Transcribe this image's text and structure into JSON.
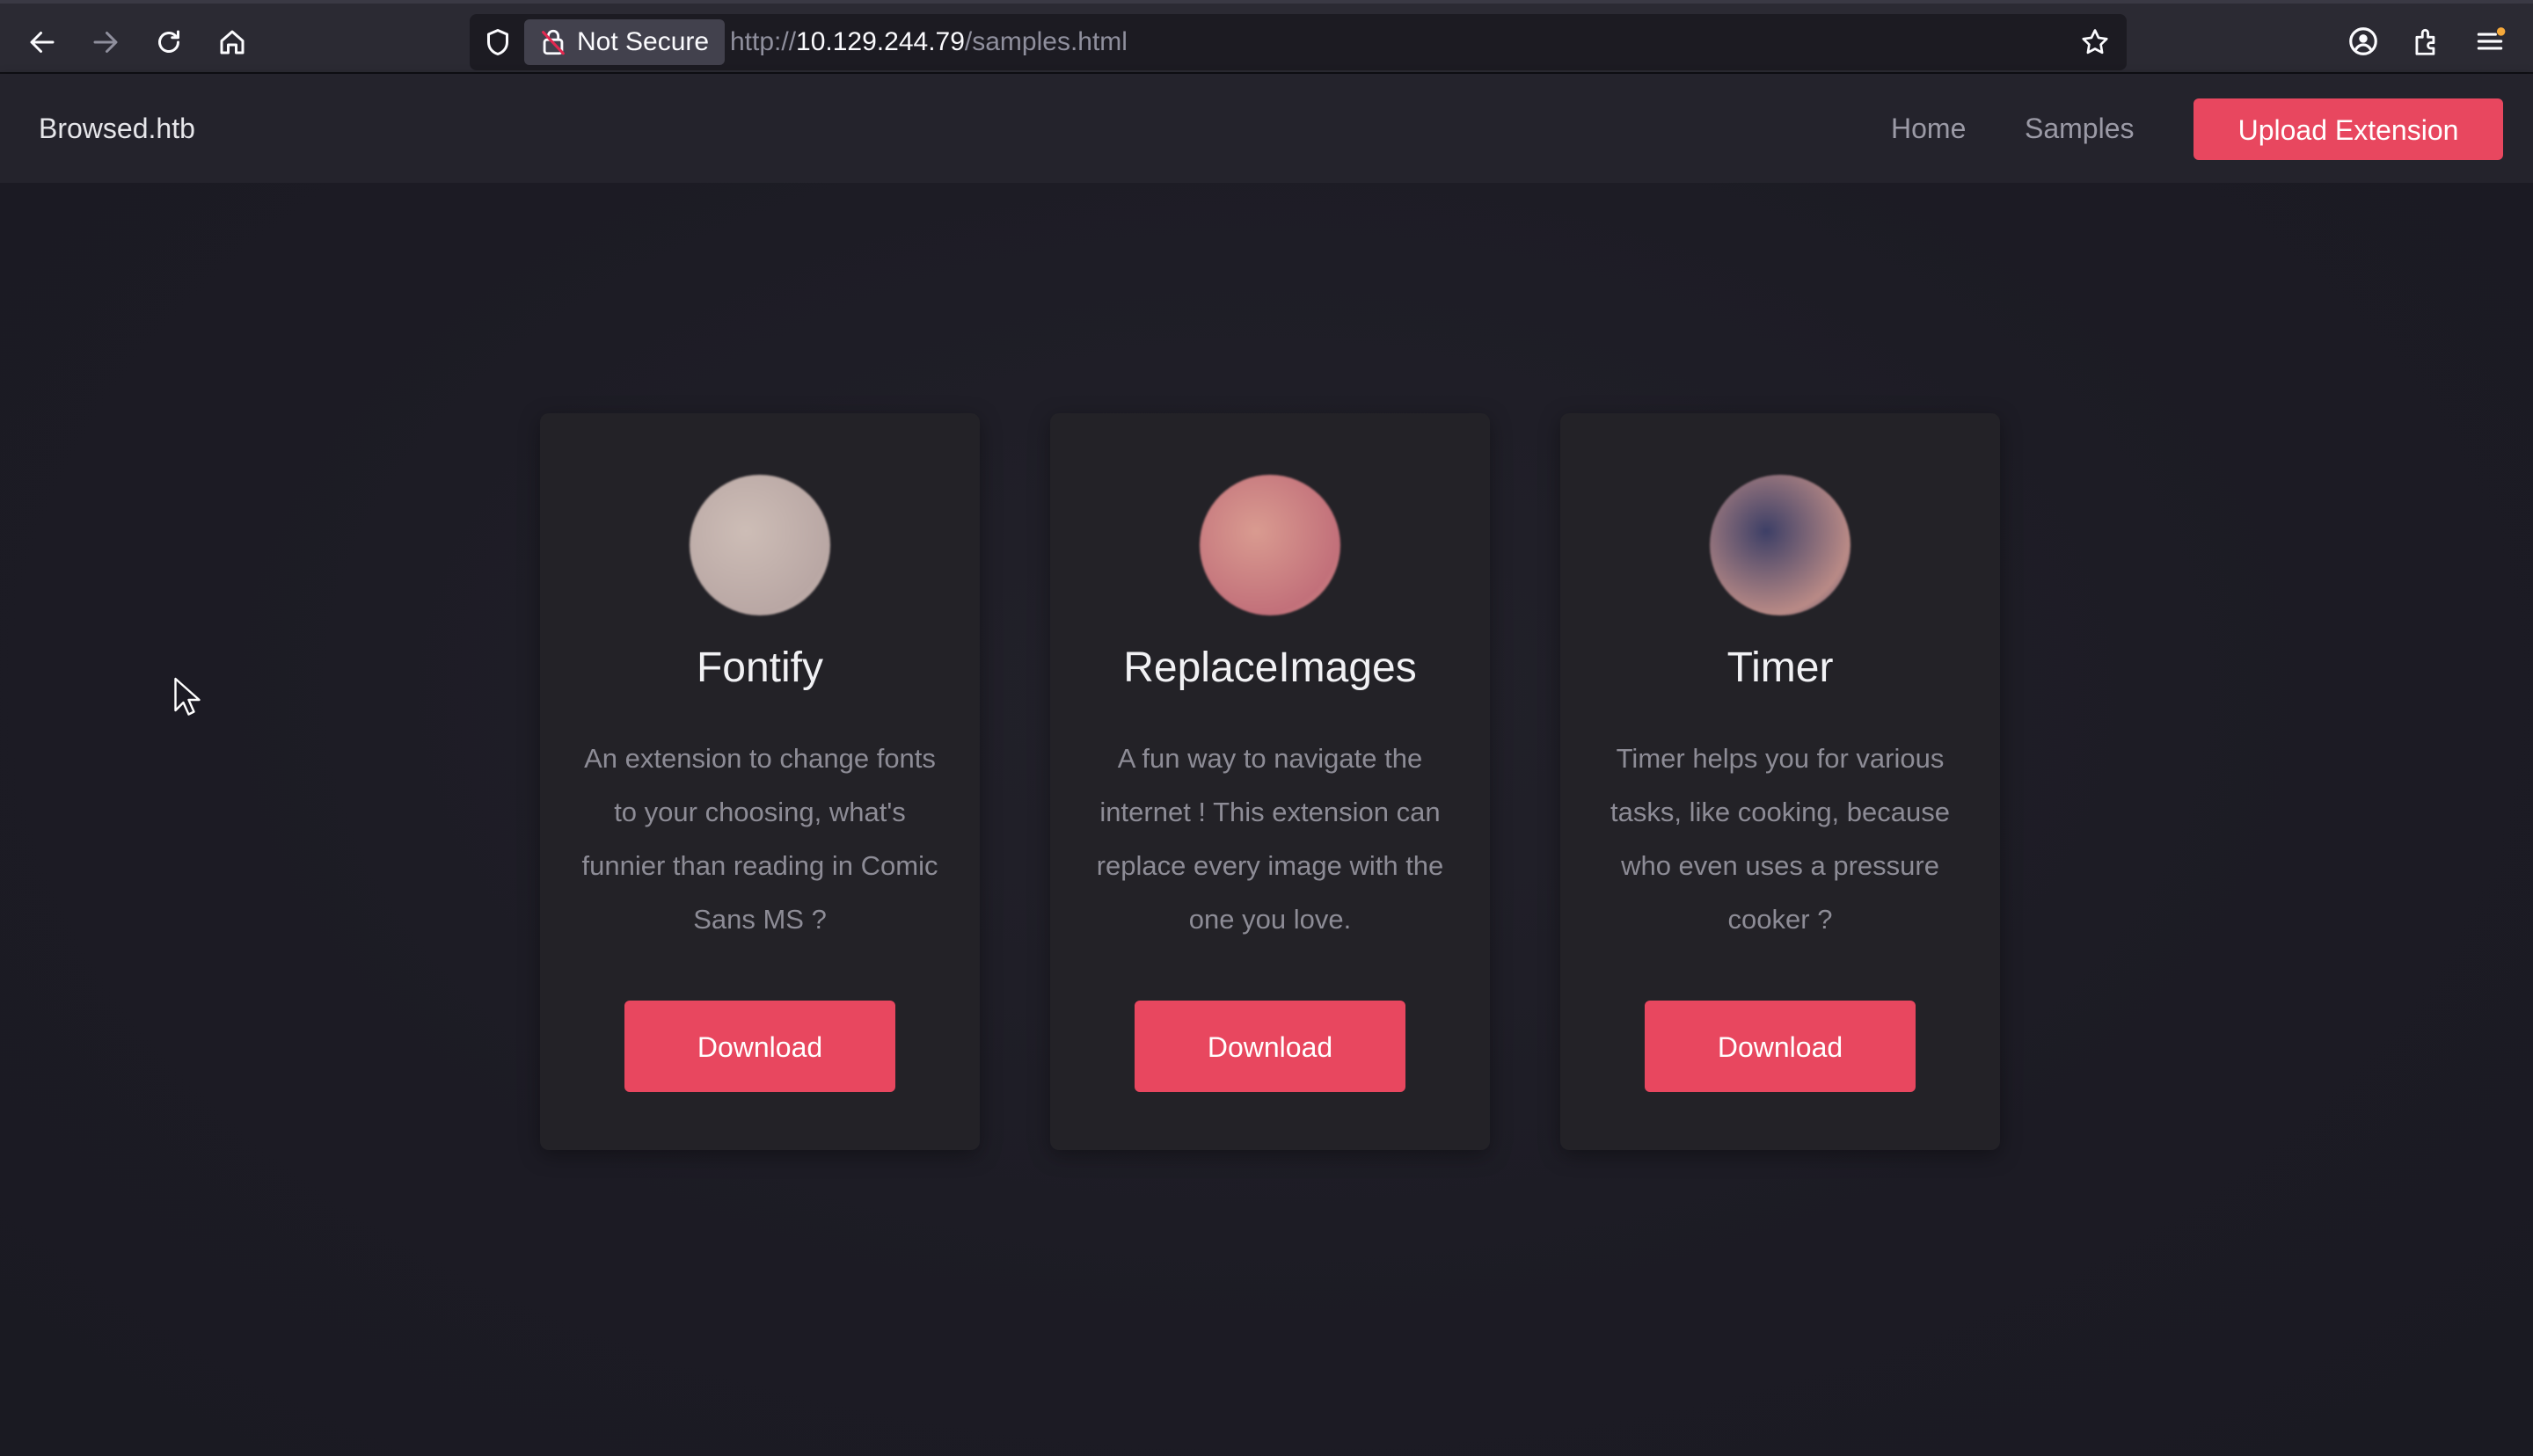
{
  "browser": {
    "security_label": "Not Secure",
    "url_scheme": "http://",
    "url_host": "10.129.244.79",
    "url_path": "/samples.html"
  },
  "site": {
    "brand": "Browsed.htb",
    "nav": {
      "home": "Home",
      "samples": "Samples",
      "upload": "Upload Extension"
    }
  },
  "cards": [
    {
      "title": "Fontify",
      "description": "An extension to change fonts to your choosing, what's funnier than reading in Comic Sans MS ?",
      "button": "Download",
      "avatar_colors": [
        "#cdbdb6",
        "#b9a7a4"
      ]
    },
    {
      "title": "ReplaceImages",
      "description": "A fun way to navigate the internet ! This extension can replace every image with the one you love.",
      "button": "Download",
      "avatar_colors": [
        "#d99b90",
        "#c2707a"
      ]
    },
    {
      "title": "Timer",
      "description": "Timer helps you for various tasks, like cooking, because who even uses a pressure cooker ?",
      "button": "Download",
      "avatar_colors": [
        "#3d3f66",
        "#b98a86"
      ]
    }
  ],
  "colors": {
    "accent": "#e8475f",
    "page_bg": "#1c1b24",
    "card_bg": "#232227"
  }
}
